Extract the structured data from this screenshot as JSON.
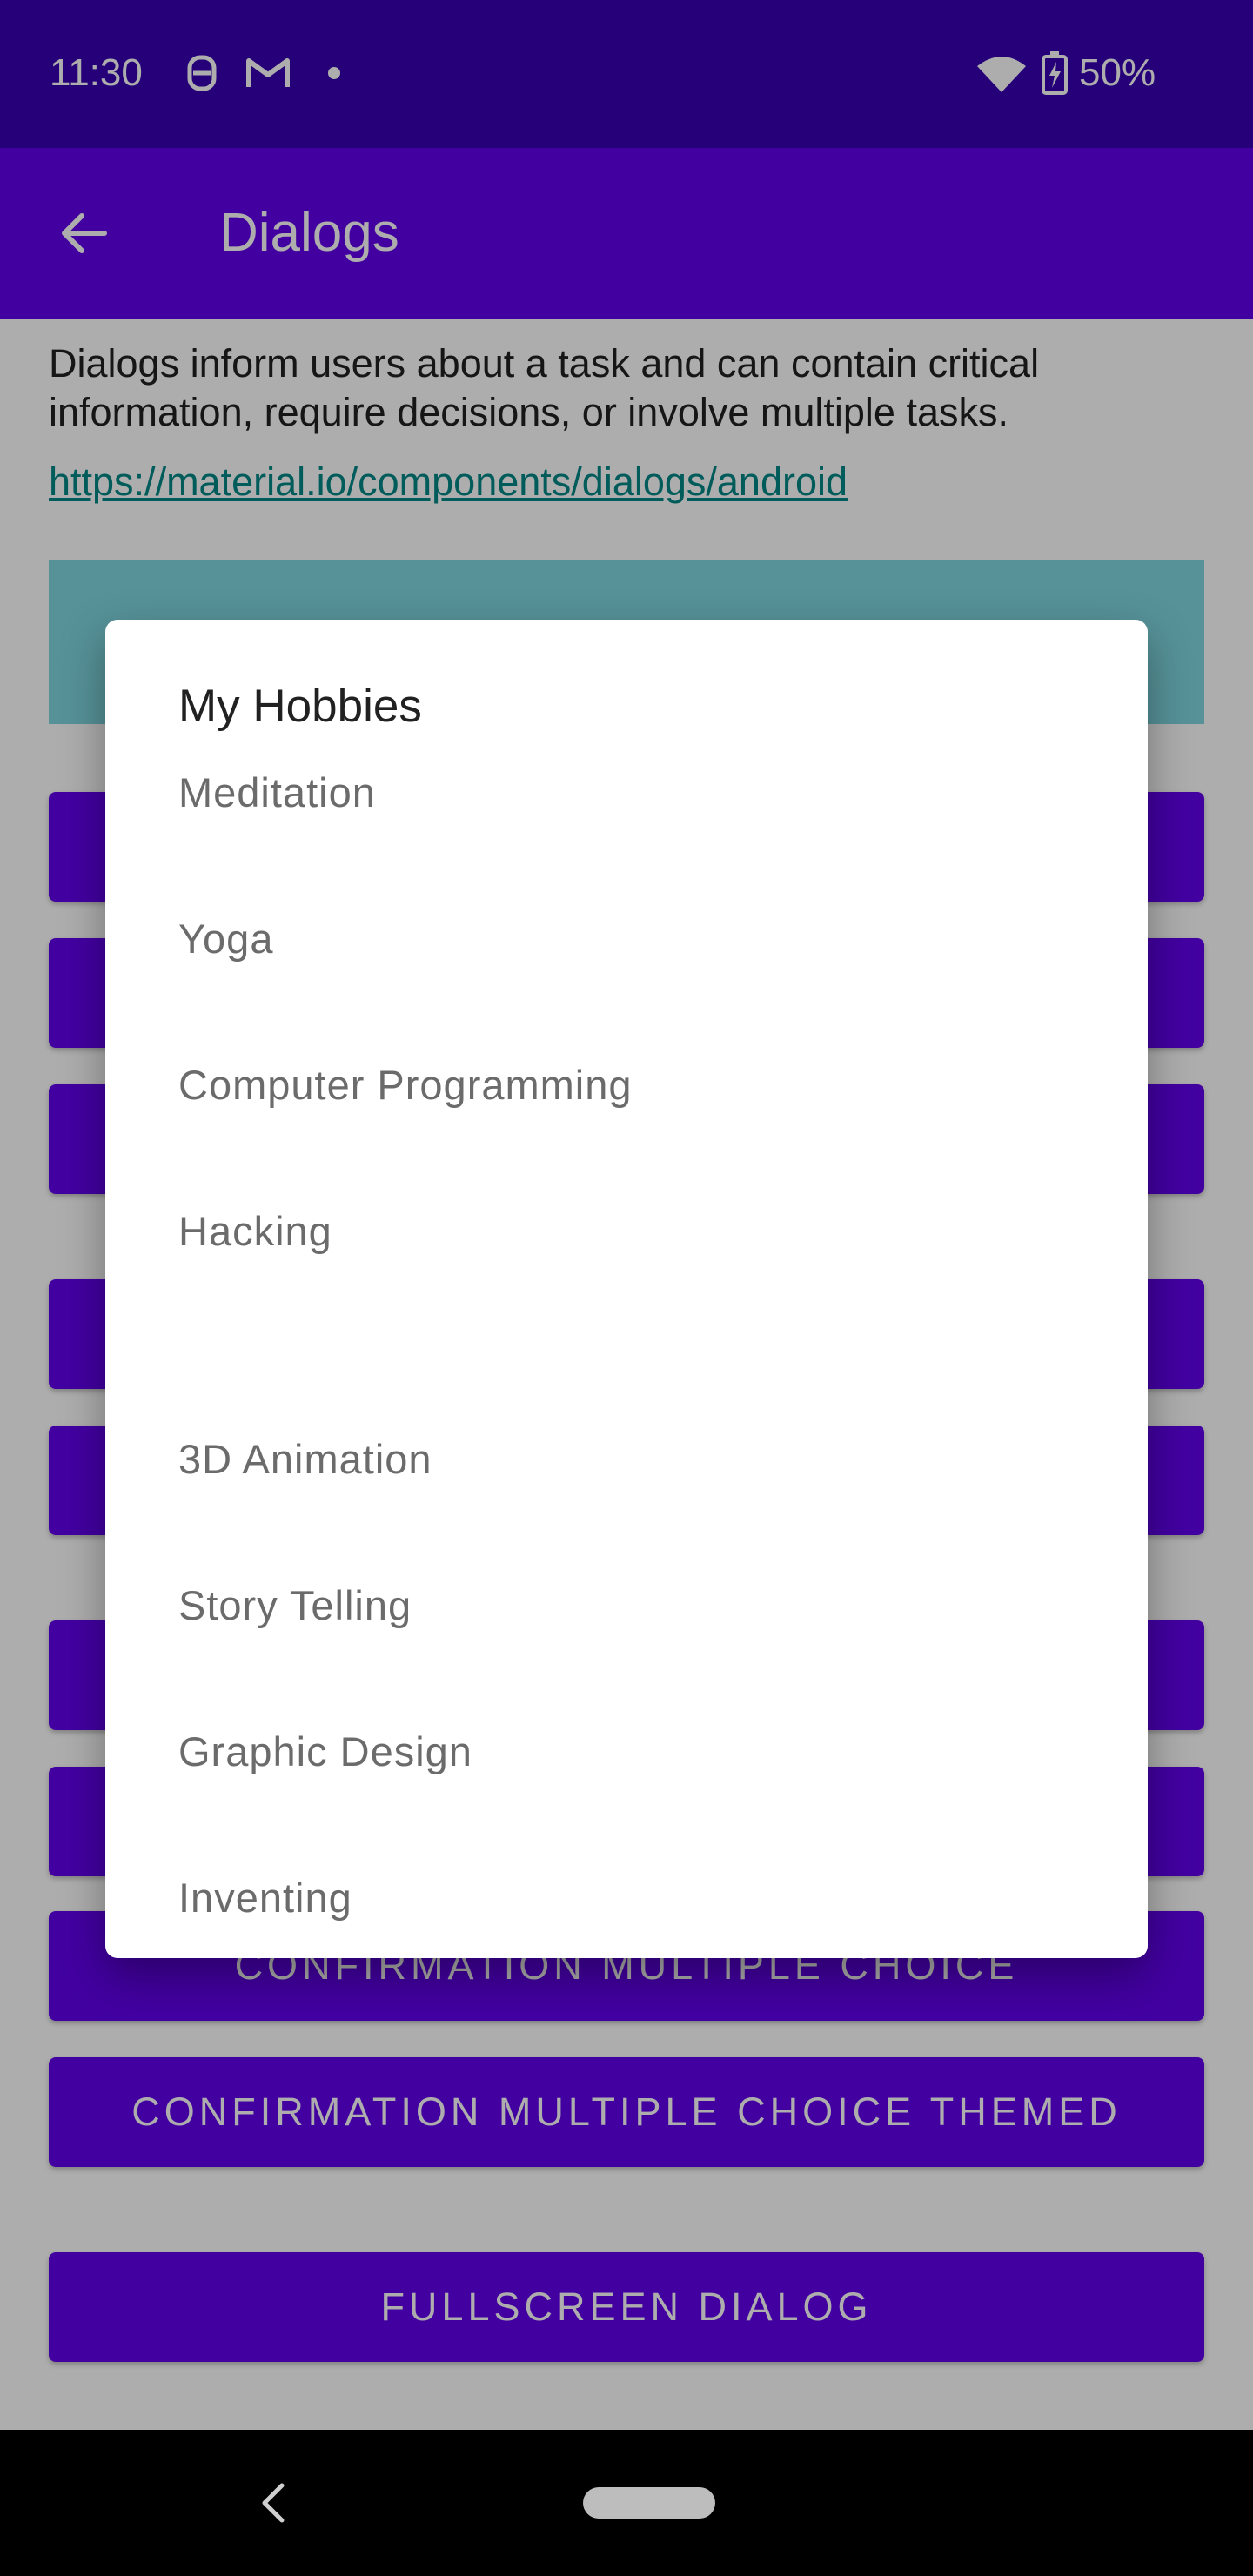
{
  "status_bar": {
    "time": "11:30",
    "battery": "50%",
    "icons": [
      "s-logo-icon",
      "gmail-icon",
      "dot-icon",
      "wifi-icon",
      "battery-charging-icon"
    ]
  },
  "app_bar": {
    "title": "Dialogs",
    "back_icon": "arrow-back-icon"
  },
  "content": {
    "description": "Dialogs inform users about a task and can contain critical information, require decisions, or involve multiple tasks.",
    "link": "https://material.io/components/dialogs/android",
    "buttons": [
      {
        "label": "CONFIRMATION MULTIPLE CHOICE"
      },
      {
        "label": "CONFIRMATION MULTIPLE CHOICE THEMED"
      },
      {
        "label": "FULLSCREEN DIALOG"
      }
    ]
  },
  "dialog": {
    "title": "My Hobbies",
    "items": [
      {
        "label": "Meditation"
      },
      {
        "label": "Yoga"
      },
      {
        "label": "Computer Programming"
      },
      {
        "label": "Hacking"
      },
      {
        "label": "3D Animation"
      },
      {
        "label": "Story Telling"
      },
      {
        "label": "Graphic Design"
      },
      {
        "label": "Inventing"
      }
    ]
  },
  "colors": {
    "status_bar": "#3700b3",
    "app_bar": "#6200ee",
    "link": "#018786",
    "banner": "#7fd8e0"
  }
}
